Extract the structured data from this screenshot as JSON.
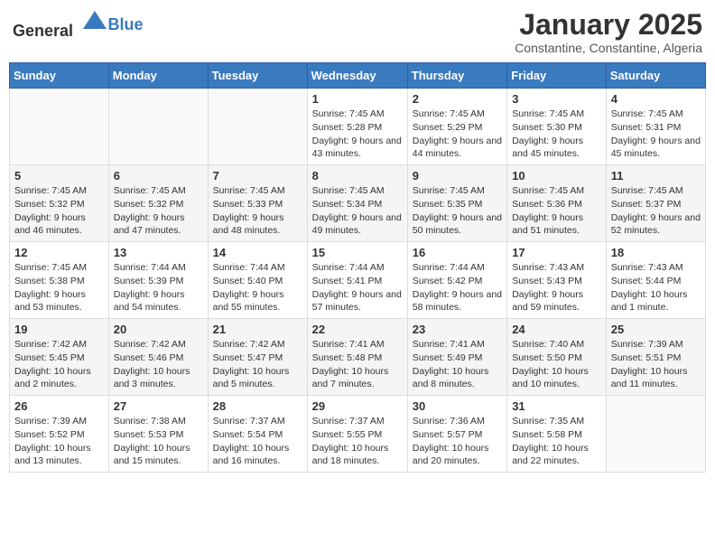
{
  "header": {
    "logo_general": "General",
    "logo_blue": "Blue",
    "month_title": "January 2025",
    "location": "Constantine, Constantine, Algeria"
  },
  "days_of_week": [
    "Sunday",
    "Monday",
    "Tuesday",
    "Wednesday",
    "Thursday",
    "Friday",
    "Saturday"
  ],
  "weeks": [
    [
      {
        "day": "",
        "info": ""
      },
      {
        "day": "",
        "info": ""
      },
      {
        "day": "",
        "info": ""
      },
      {
        "day": "1",
        "info": "Sunrise: 7:45 AM\nSunset: 5:28 PM\nDaylight: 9 hours and 43 minutes."
      },
      {
        "day": "2",
        "info": "Sunrise: 7:45 AM\nSunset: 5:29 PM\nDaylight: 9 hours and 44 minutes."
      },
      {
        "day": "3",
        "info": "Sunrise: 7:45 AM\nSunset: 5:30 PM\nDaylight: 9 hours and 45 minutes."
      },
      {
        "day": "4",
        "info": "Sunrise: 7:45 AM\nSunset: 5:31 PM\nDaylight: 9 hours and 45 minutes."
      }
    ],
    [
      {
        "day": "5",
        "info": "Sunrise: 7:45 AM\nSunset: 5:32 PM\nDaylight: 9 hours and 46 minutes."
      },
      {
        "day": "6",
        "info": "Sunrise: 7:45 AM\nSunset: 5:32 PM\nDaylight: 9 hours and 47 minutes."
      },
      {
        "day": "7",
        "info": "Sunrise: 7:45 AM\nSunset: 5:33 PM\nDaylight: 9 hours and 48 minutes."
      },
      {
        "day": "8",
        "info": "Sunrise: 7:45 AM\nSunset: 5:34 PM\nDaylight: 9 hours and 49 minutes."
      },
      {
        "day": "9",
        "info": "Sunrise: 7:45 AM\nSunset: 5:35 PM\nDaylight: 9 hours and 50 minutes."
      },
      {
        "day": "10",
        "info": "Sunrise: 7:45 AM\nSunset: 5:36 PM\nDaylight: 9 hours and 51 minutes."
      },
      {
        "day": "11",
        "info": "Sunrise: 7:45 AM\nSunset: 5:37 PM\nDaylight: 9 hours and 52 minutes."
      }
    ],
    [
      {
        "day": "12",
        "info": "Sunrise: 7:45 AM\nSunset: 5:38 PM\nDaylight: 9 hours and 53 minutes."
      },
      {
        "day": "13",
        "info": "Sunrise: 7:44 AM\nSunset: 5:39 PM\nDaylight: 9 hours and 54 minutes."
      },
      {
        "day": "14",
        "info": "Sunrise: 7:44 AM\nSunset: 5:40 PM\nDaylight: 9 hours and 55 minutes."
      },
      {
        "day": "15",
        "info": "Sunrise: 7:44 AM\nSunset: 5:41 PM\nDaylight: 9 hours and 57 minutes."
      },
      {
        "day": "16",
        "info": "Sunrise: 7:44 AM\nSunset: 5:42 PM\nDaylight: 9 hours and 58 minutes."
      },
      {
        "day": "17",
        "info": "Sunrise: 7:43 AM\nSunset: 5:43 PM\nDaylight: 9 hours and 59 minutes."
      },
      {
        "day": "18",
        "info": "Sunrise: 7:43 AM\nSunset: 5:44 PM\nDaylight: 10 hours and 1 minute."
      }
    ],
    [
      {
        "day": "19",
        "info": "Sunrise: 7:42 AM\nSunset: 5:45 PM\nDaylight: 10 hours and 2 minutes."
      },
      {
        "day": "20",
        "info": "Sunrise: 7:42 AM\nSunset: 5:46 PM\nDaylight: 10 hours and 3 minutes."
      },
      {
        "day": "21",
        "info": "Sunrise: 7:42 AM\nSunset: 5:47 PM\nDaylight: 10 hours and 5 minutes."
      },
      {
        "day": "22",
        "info": "Sunrise: 7:41 AM\nSunset: 5:48 PM\nDaylight: 10 hours and 7 minutes."
      },
      {
        "day": "23",
        "info": "Sunrise: 7:41 AM\nSunset: 5:49 PM\nDaylight: 10 hours and 8 minutes."
      },
      {
        "day": "24",
        "info": "Sunrise: 7:40 AM\nSunset: 5:50 PM\nDaylight: 10 hours and 10 minutes."
      },
      {
        "day": "25",
        "info": "Sunrise: 7:39 AM\nSunset: 5:51 PM\nDaylight: 10 hours and 11 minutes."
      }
    ],
    [
      {
        "day": "26",
        "info": "Sunrise: 7:39 AM\nSunset: 5:52 PM\nDaylight: 10 hours and 13 minutes."
      },
      {
        "day": "27",
        "info": "Sunrise: 7:38 AM\nSunset: 5:53 PM\nDaylight: 10 hours and 15 minutes."
      },
      {
        "day": "28",
        "info": "Sunrise: 7:37 AM\nSunset: 5:54 PM\nDaylight: 10 hours and 16 minutes."
      },
      {
        "day": "29",
        "info": "Sunrise: 7:37 AM\nSunset: 5:55 PM\nDaylight: 10 hours and 18 minutes."
      },
      {
        "day": "30",
        "info": "Sunrise: 7:36 AM\nSunset: 5:57 PM\nDaylight: 10 hours and 20 minutes."
      },
      {
        "day": "31",
        "info": "Sunrise: 7:35 AM\nSunset: 5:58 PM\nDaylight: 10 hours and 22 minutes."
      },
      {
        "day": "",
        "info": ""
      }
    ]
  ]
}
